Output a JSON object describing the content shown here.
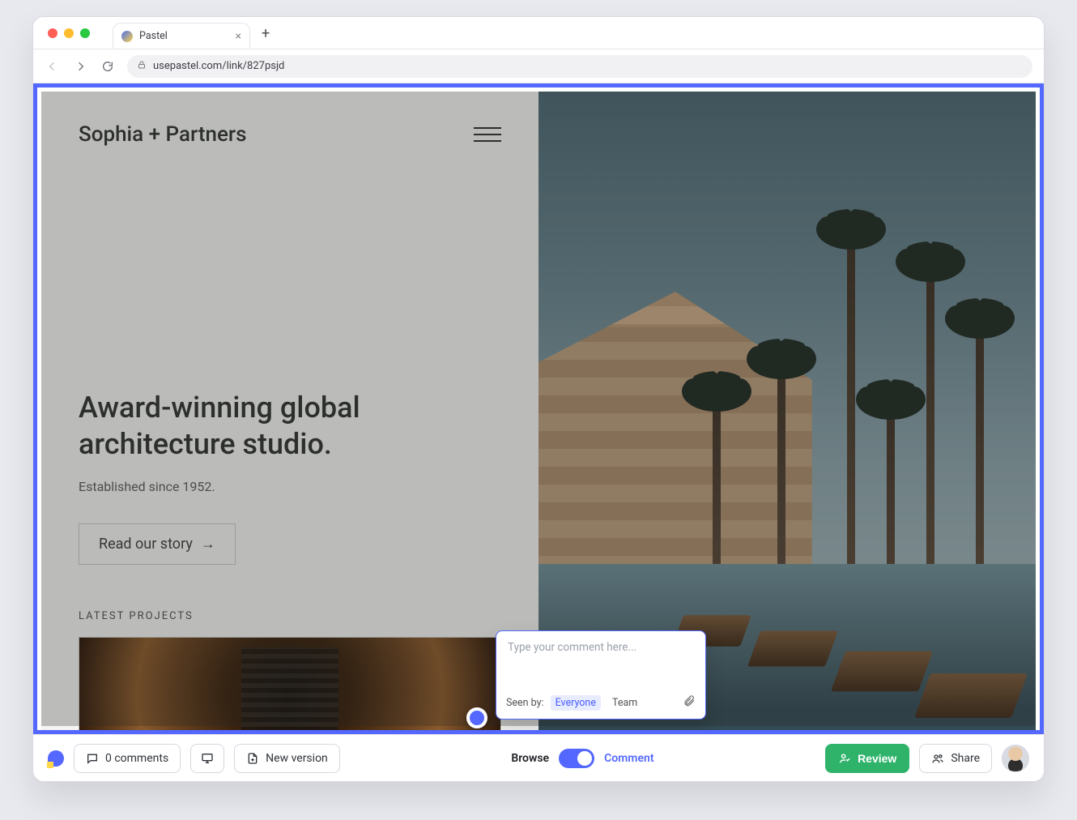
{
  "browser": {
    "tab_title": "Pastel",
    "url": "usepastel.com/link/827psjd"
  },
  "site": {
    "brand": "Sophia + Partners",
    "hero_line1": "Award-winning global",
    "hero_line2": "architecture studio.",
    "subtitle": "Established since 1952.",
    "cta": "Read our story",
    "section_label": "LATEST PROJECTS"
  },
  "comment_popover": {
    "placeholder": "Type your comment here...",
    "seen_by_label": "Seen by:",
    "visibility_options": [
      "Everyone",
      "Team"
    ],
    "selected_visibility": "Everyone"
  },
  "appbar": {
    "comments_label": "0 comments",
    "new_version_label": "New version",
    "mode_browse": "Browse",
    "mode_comment": "Comment",
    "review_label": "Review",
    "share_label": "Share"
  },
  "colors": {
    "accent": "#5468ff",
    "review_green": "#2fb36b"
  }
}
